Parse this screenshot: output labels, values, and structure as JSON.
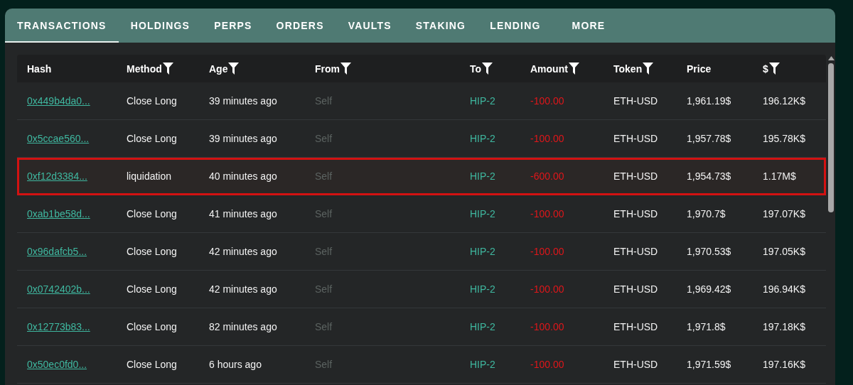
{
  "tabs": [
    {
      "label": "TRANSACTIONS",
      "selected": true
    },
    {
      "label": "HOLDINGS",
      "selected": false
    },
    {
      "label": "PERPS",
      "selected": false
    },
    {
      "label": "ORDERS",
      "selected": false
    },
    {
      "label": "VAULTS",
      "selected": false
    },
    {
      "label": "STAKING",
      "selected": false
    },
    {
      "label": "LENDING",
      "selected": false
    },
    {
      "label": "MORE",
      "selected": false
    }
  ],
  "table": {
    "columns": [
      {
        "label": "Hash",
        "filter": false
      },
      {
        "label": "Method",
        "filter": true
      },
      {
        "label": "Age",
        "filter": true
      },
      {
        "label": "From",
        "filter": true
      },
      {
        "label": "To",
        "filter": true
      },
      {
        "label": "Amount",
        "filter": true
      },
      {
        "label": "Token",
        "filter": true
      },
      {
        "label": "Price",
        "filter": false
      },
      {
        "label": "$",
        "filter": true
      }
    ],
    "rows": [
      {
        "hash": "0x449b4da0...",
        "method": "Close Long",
        "age": "39 minutes ago",
        "from": "Self",
        "to": "HIP-2",
        "amount": "-100.00",
        "token": "ETH-USD",
        "price": "1,961.19$",
        "value": "196.12K$",
        "highlighted": false
      },
      {
        "hash": "0x5ccae560...",
        "method": "Close Long",
        "age": "39 minutes ago",
        "from": "Self",
        "to": "HIP-2",
        "amount": "-100.00",
        "token": "ETH-USD",
        "price": "1,957.78$",
        "value": "195.78K$",
        "highlighted": false
      },
      {
        "hash": "0xf12d3384...",
        "method": "liquidation",
        "age": "40 minutes ago",
        "from": "Self",
        "to": "HIP-2",
        "amount": "-600.00",
        "token": "ETH-USD",
        "price": "1,954.73$",
        "value": "1.17M$",
        "highlighted": true
      },
      {
        "hash": "0xab1be58d...",
        "method": "Close Long",
        "age": "41 minutes ago",
        "from": "Self",
        "to": "HIP-2",
        "amount": "-100.00",
        "token": "ETH-USD",
        "price": "1,970.7$",
        "value": "197.07K$",
        "highlighted": false
      },
      {
        "hash": "0x96dafcb5...",
        "method": "Close Long",
        "age": "42 minutes ago",
        "from": "Self",
        "to": "HIP-2",
        "amount": "-100.00",
        "token": "ETH-USD",
        "price": "1,970.53$",
        "value": "197.05K$",
        "highlighted": false
      },
      {
        "hash": "0x0742402b...",
        "method": "Close Long",
        "age": "42 minutes ago",
        "from": "Self",
        "to": "HIP-2",
        "amount": "-100.00",
        "token": "ETH-USD",
        "price": "1,969.42$",
        "value": "196.94K$",
        "highlighted": false
      },
      {
        "hash": "0x12773b83...",
        "method": "Close Long",
        "age": "82 minutes ago",
        "from": "Self",
        "to": "HIP-2",
        "amount": "-100.00",
        "token": "ETH-USD",
        "price": "1,971.8$",
        "value": "197.18K$",
        "highlighted": false
      },
      {
        "hash": "0x50ec0fd0...",
        "method": "Close Long",
        "age": "6 hours ago",
        "from": "Self",
        "to": "HIP-2",
        "amount": "-100.00",
        "token": "ETH-USD",
        "price": "1,971.59$",
        "value": "197.16K$",
        "highlighted": false
      }
    ]
  }
}
